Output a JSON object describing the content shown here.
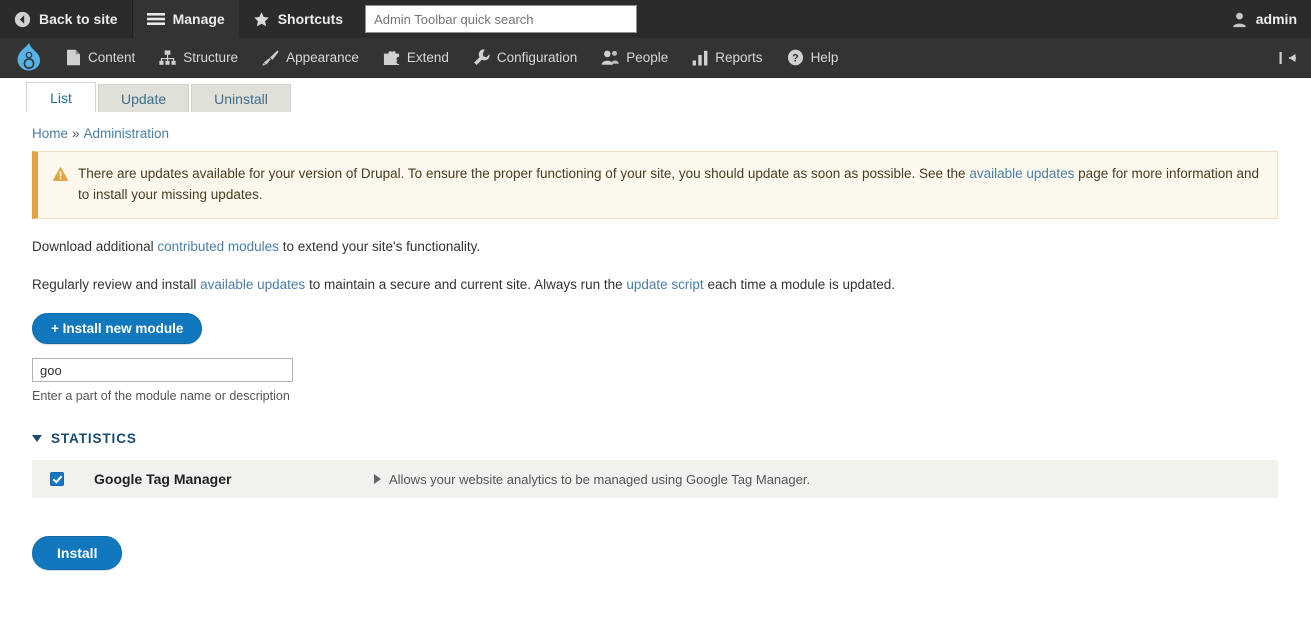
{
  "toolbar": {
    "back_to_site": "Back to site",
    "manage": "Manage",
    "shortcuts": "Shortcuts",
    "search_placeholder": "Admin Toolbar quick search",
    "search_value": "",
    "user": "admin",
    "icons": {
      "back": "back-arrow-icon",
      "manage": "hamburger-icon",
      "shortcuts": "star-icon",
      "user": "person-icon"
    }
  },
  "menu": {
    "logo": "drupal-logo",
    "items": [
      {
        "label": "Content",
        "icon": "file-icon"
      },
      {
        "label": "Structure",
        "icon": "sitemap-icon"
      },
      {
        "label": "Appearance",
        "icon": "paintbrush-icon"
      },
      {
        "label": "Extend",
        "icon": "puzzle-piece-icon"
      },
      {
        "label": "Configuration",
        "icon": "wrench-icon"
      },
      {
        "label": "People",
        "icon": "people-icon"
      },
      {
        "label": "Reports",
        "icon": "bar-chart-icon"
      },
      {
        "label": "Help",
        "icon": "question-mark-icon"
      }
    ],
    "collapse_icon": "collapse-toolbar-icon"
  },
  "tabs": [
    {
      "label": "List",
      "active": true
    },
    {
      "label": "Update",
      "active": false
    },
    {
      "label": "Uninstall",
      "active": false
    }
  ],
  "breadcrumb": {
    "home": "Home",
    "separator": "»",
    "current": "Administration"
  },
  "warning": {
    "icon": "warning-triangle-icon",
    "text_before": "There are updates available for your version of Drupal. To ensure the proper functioning of your site, you should update as soon as possible. See the",
    "link": "available updates",
    "text_after": "page for more information and to install your missing updates."
  },
  "paragraphs": {
    "p1_before": "Download additional",
    "p1_link": "contributed modules",
    "p1_after": "to extend your site's functionality.",
    "p2_before": "Regularly review and install",
    "p2_link1": "available updates",
    "p2_middle": "to maintain a secure and current site. Always run the",
    "p2_link2": "update script",
    "p2_after": "each time a module is updated."
  },
  "install_new_module_button": "+ Install new module",
  "filter": {
    "value": "goo",
    "placeholder": "",
    "description": "Enter a part of the module name or description"
  },
  "section": {
    "title": "STATISTICS",
    "expanded": true,
    "caret_icon": "caret-down-icon"
  },
  "module": {
    "checked": true,
    "name": "Google Tag Manager",
    "description": "Allows your website analytics to be managed using Google Tag Manager.",
    "caret_icon": "caret-right-icon"
  },
  "install_button": "Install",
  "colors": {
    "toolbar_top": "#2b2b2b",
    "toolbar_menu": "#333333",
    "accent_blue": "#1278be",
    "link_blue": "#4a7fa5",
    "warning_bg": "#fdf8ed",
    "warning_border": "#e0a33e",
    "row_bg": "#f1f1ed",
    "drupal_logo": "#55b3e8"
  }
}
